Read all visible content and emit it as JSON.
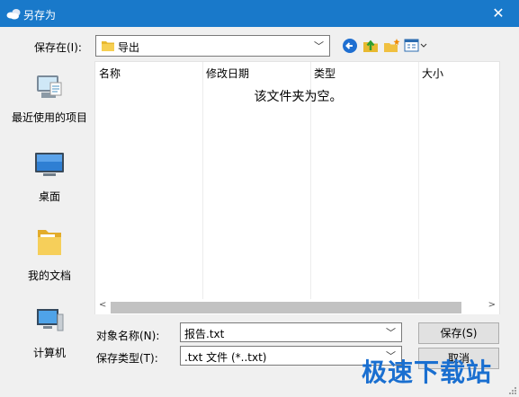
{
  "window": {
    "title": "另存为",
    "close_glyph": "✕"
  },
  "location": {
    "label": "保存在(I):",
    "value": "导出"
  },
  "toolbar": {
    "icons": [
      "back-icon",
      "up-folder-icon",
      "new-folder-icon",
      "view-menu-icon"
    ]
  },
  "places": [
    {
      "label": "最近使用的项目",
      "icon": "recent-items-icon"
    },
    {
      "label": "桌面",
      "icon": "desktop-icon"
    },
    {
      "label": "我的文档",
      "icon": "documents-icon"
    },
    {
      "label": "计算机",
      "icon": "computer-icon"
    }
  ],
  "filelist": {
    "columns": [
      "名称",
      "修改日期",
      "类型",
      "大小"
    ],
    "empty_message": "该文件夹为空。"
  },
  "filename": {
    "label": "对象名称(N):",
    "value": "报告.txt"
  },
  "filetype": {
    "label": "保存类型(T):",
    "value": ".txt 文件 (*..txt)"
  },
  "buttons": {
    "save": "保存(S)",
    "cancel": "取消"
  },
  "watermark": "极速下载站",
  "colors": {
    "titlebar": "#1979ca",
    "dialog_bg": "#f0f0f0"
  }
}
